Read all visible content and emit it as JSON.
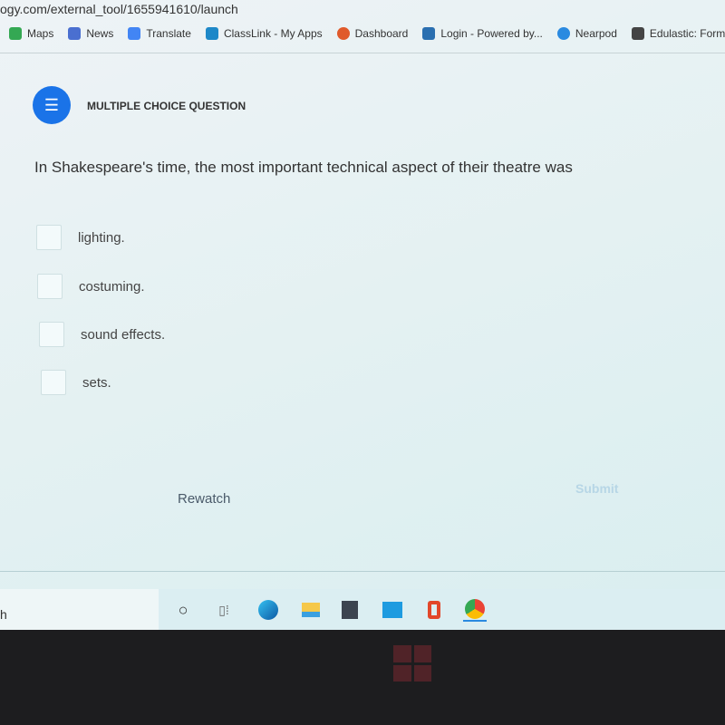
{
  "browser": {
    "url": "ogy.com/external_tool/1655941610/launch",
    "bookmarks": [
      {
        "label": "Maps",
        "icon": "maps-icon",
        "color": "#34a853"
      },
      {
        "label": "News",
        "icon": "news-icon",
        "color": "#4a6fd0"
      },
      {
        "label": "Translate",
        "icon": "translate-icon",
        "color": "#4285f4"
      },
      {
        "label": "ClassLink - My Apps",
        "icon": "classlink-icon",
        "color": "#1e88c8"
      },
      {
        "label": "Dashboard",
        "icon": "dashboard-icon",
        "color": "#e05a2b"
      },
      {
        "label": "Login - Powered by...",
        "icon": "login-icon",
        "color": "#2a6fb0"
      },
      {
        "label": "Nearpod",
        "icon": "nearpod-icon",
        "color": "#2a8ae0"
      },
      {
        "label": "Edulastic: Formativ",
        "icon": "edulastic-icon",
        "color": "#444"
      }
    ]
  },
  "question": {
    "type": "MULTIPLE CHOICE QUESTION",
    "text": "In Shakespeare's time, the most important technical aspect of their theatre was",
    "options": [
      "lighting.",
      "costuming.",
      "sound effects.",
      "sets."
    ]
  },
  "actions": {
    "rewatch": "Rewatch",
    "submit": "Submit"
  },
  "taskbar": {
    "search_fragment": "h",
    "apps": [
      "cortana",
      "task-view",
      "edge",
      "file-explorer",
      "store",
      "mail",
      "office",
      "chrome"
    ]
  },
  "colors": {
    "accent": "#1a73e8"
  }
}
